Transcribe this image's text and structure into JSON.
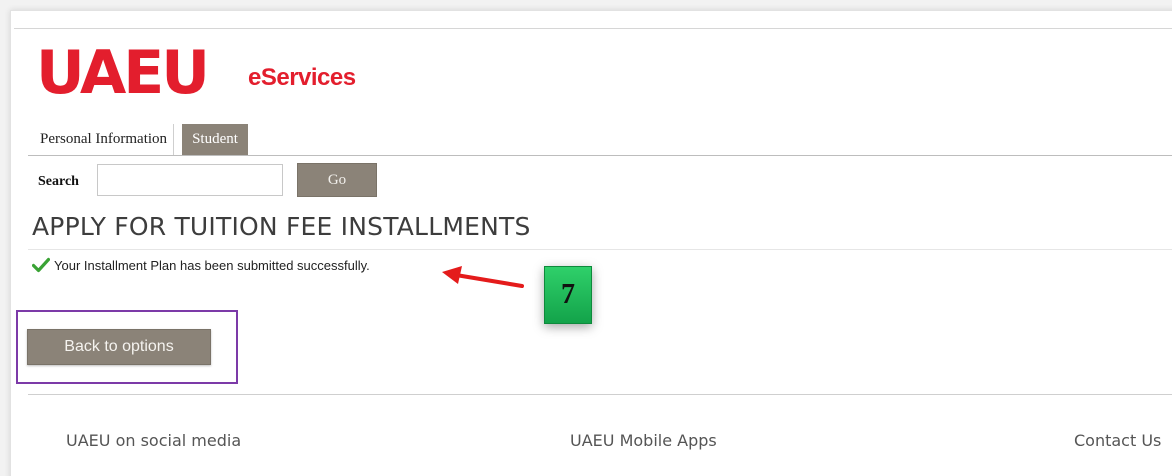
{
  "brand": {
    "logo_text": "UAEU",
    "app_name": "eServices",
    "color": "#e31e2d"
  },
  "tabs": [
    {
      "label": "Personal Information",
      "active": false
    },
    {
      "label": "Student",
      "active": true
    }
  ],
  "search": {
    "label": "Search",
    "value": "",
    "button_label": "Go"
  },
  "page": {
    "title": "APPLY FOR TUITION FEE INSTALLMENTS",
    "success_message": "Your Installment Plan has been submitted successfully.",
    "back_button_label": "Back to options"
  },
  "annotation": {
    "step_number": "7",
    "arrow_color": "#e41b1b",
    "badge_color": "#1fb85a",
    "highlight_color": "#7c3aa8"
  },
  "footer": {
    "links": [
      "UAEU on social media",
      "UAEU Mobile Apps",
      "Contact Us"
    ]
  },
  "icons": {
    "success": "check-icon",
    "pointer": "arrow-left-icon"
  }
}
